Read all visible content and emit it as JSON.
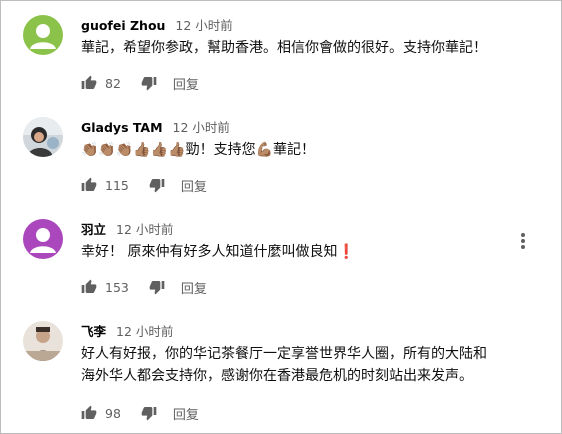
{
  "comments": [
    {
      "author": "guofei Zhou",
      "time": "12 小时前",
      "text": "華記，希望你参政，幫助香港。相信你會做的很好。支持你華記！",
      "likes": "82",
      "reply_label": "回复"
    },
    {
      "author": "Gladys TAM",
      "time": "12 小时前",
      "text_prefix_emoji": "👏🏽👏🏽👏🏽👍🏽👍🏽👍🏽",
      "text_middle": "勁！支持您",
      "text_emoji2": "💪🏽",
      "text_suffix": "華記！",
      "likes": "115",
      "reply_label": "回复"
    },
    {
      "author": "羽立",
      "time": "12 小时前",
      "text": "幸好！ 原來仲有好多人知道什麼叫做良知",
      "text_emoji": "❗",
      "likes": "153",
      "reply_label": "回复"
    },
    {
      "author": "飞李",
      "time": "12 小时前",
      "text": "好人有好报，你的华记茶餐厅一定享誉世界华人圈，所有的大陆和\n海外华人都会支持你，感谢你在香港最危机的时刻站出来发声。",
      "likes": "98",
      "reply_label": "回复"
    }
  ],
  "colors": {
    "avatar_green": "#8bc34a",
    "avatar_purple": "#ab47bc",
    "meta_gray": "#606060",
    "text": "#0f0f0f"
  },
  "icons": {
    "like": "thumb-up-icon",
    "dislike": "thumb-down-icon",
    "menu": "more-vert-icon"
  }
}
